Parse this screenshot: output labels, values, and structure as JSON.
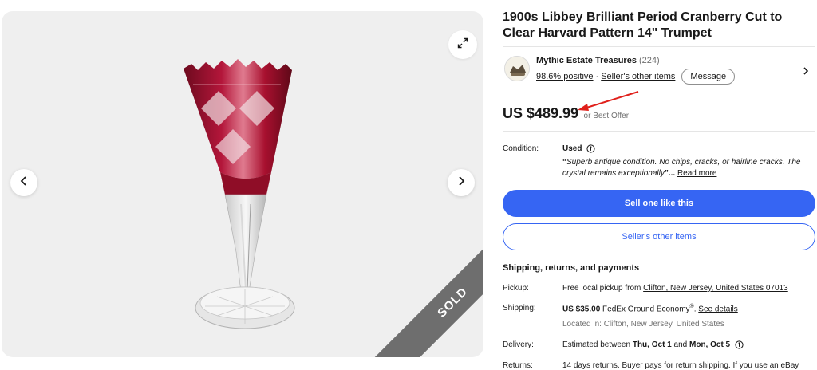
{
  "gallery": {
    "sold_label": "SOLD",
    "icons": {
      "expand": "expand-icon",
      "prev": "chevron-left-icon",
      "next": "chevron-right-icon"
    }
  },
  "listing": {
    "title": "1900s Libbey Brilliant Period Cranberry Cut to Clear Harvard Pattern 14\" Trumpet"
  },
  "seller": {
    "name": "Mythic Estate Treasures",
    "count": "(224)",
    "feedback": "98.6% positive",
    "separator": "·",
    "other_items": "Seller's other items",
    "message_label": "Message"
  },
  "price": {
    "amount": "US $489.99",
    "best_offer": "or Best Offer"
  },
  "condition": {
    "label": "Condition:",
    "value": "Used",
    "quote_open": "“",
    "description": "Superb antique condition. No chips, cracks, or hairline cracks. The crystal remains exceptionally",
    "quote_close": "”...",
    "read_more": "Read more"
  },
  "actions": {
    "sell_one": "Sell one like this",
    "seller_items": "Seller's other items"
  },
  "shipping": {
    "heading": "Shipping, returns, and payments",
    "pickup_label": "Pickup:",
    "pickup_text": "Free local pickup from",
    "pickup_location": "Clifton, New Jersey, United States 07013",
    "shipping_label": "Shipping:",
    "shipping_price": "US $35.00",
    "shipping_service": "FedEx Ground Economy",
    "shipping_reg": "®",
    "shipping_period": ".",
    "see_details": "See details",
    "located_in": "Located in: Clifton, New Jersey, United States",
    "delivery_label": "Delivery:",
    "delivery_text": "Estimated between",
    "delivery_start": "Thu, Oct 1",
    "delivery_and": "and",
    "delivery_end": "Mon, Oct 5",
    "returns_label": "Returns:",
    "returns_text": "14 days returns. Buyer pays for return shipping. If you use an eBay"
  },
  "colors": {
    "primary": "#3665f3",
    "text": "#191919",
    "muted": "#707070",
    "sold_banner": "#6e6e6e",
    "annotation_arrow": "#e0201b",
    "glass_cranberry": "#a8102f"
  }
}
